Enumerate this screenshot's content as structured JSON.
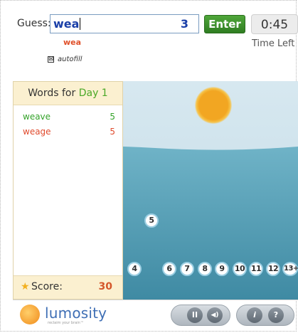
{
  "guess": {
    "label": "Guess:",
    "value": "wea",
    "count": "3",
    "echo": "wea"
  },
  "enter_button": "Enter",
  "timer": {
    "value": "0:45",
    "label": "Time Left"
  },
  "autofill": {
    "label": "autofill",
    "mark": "⊠",
    "checked": true
  },
  "words_panel": {
    "title_prefix": "Words for",
    "day": "Day 1",
    "words": [
      {
        "word": "weave",
        "points": "5",
        "status": "valid",
        "color": "#35a32a"
      },
      {
        "word": "weage",
        "points": "5",
        "status": "invalid",
        "color": "#e04b2e"
      }
    ],
    "score_label": "Score:",
    "score_value": "30"
  },
  "bubbles": {
    "floating": "5",
    "row": [
      "4",
      "6",
      "7",
      "8",
      "9",
      "10",
      "11",
      "12",
      "13+"
    ]
  },
  "footer": {
    "brand": "lumosity",
    "tagline": "reclaim your brain™",
    "controls": [
      {
        "icon": "pause-icon",
        "glyph": "II"
      },
      {
        "icon": "sound-icon",
        "glyph": "◀)"
      },
      {
        "icon": "info-icon",
        "glyph": "i"
      },
      {
        "icon": "help-icon",
        "glyph": "?"
      }
    ]
  },
  "colors": {
    "accent_blue": "#1a3fa8",
    "enter_green": "#3a8f2b",
    "valid_green": "#35a32a",
    "invalid_red": "#e04b2e",
    "sea": "#5fa5bc"
  }
}
